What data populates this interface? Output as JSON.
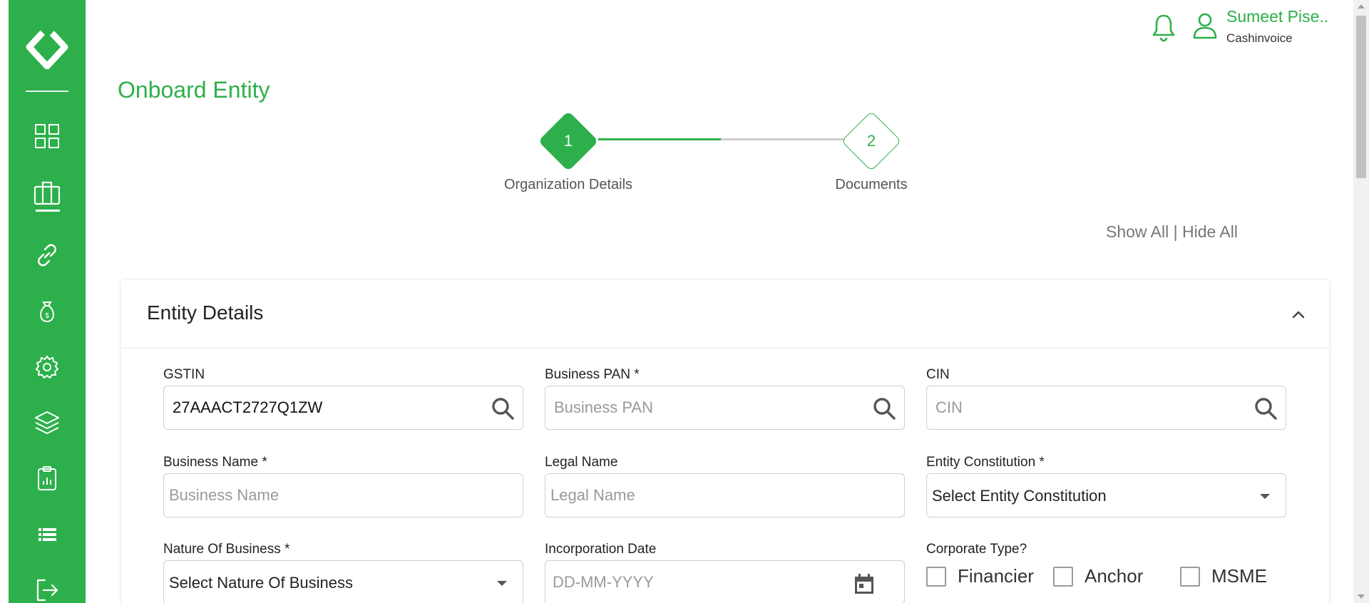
{
  "brand": {
    "accent": "#2db04b"
  },
  "sidebar": {
    "items": [
      {
        "icon": "dashboard-grid-icon"
      },
      {
        "icon": "briefcase-icon",
        "active": true
      },
      {
        "icon": "link-icon"
      },
      {
        "icon": "money-bag-icon"
      },
      {
        "icon": "gear-icon"
      },
      {
        "icon": "layers-icon"
      },
      {
        "icon": "clipboard-icon"
      },
      {
        "icon": "list-icon"
      },
      {
        "icon": "logout-icon"
      }
    ]
  },
  "header": {
    "user_name": "Sumeet Pise..",
    "company": "Cashinvoice"
  },
  "page": {
    "title": "Onboard Entity"
  },
  "stepper": {
    "steps": [
      {
        "number": "1",
        "label": "Organization Details",
        "state": "completed"
      },
      {
        "number": "2",
        "label": "Documents",
        "state": "pending"
      }
    ]
  },
  "toggles": {
    "show_all": "Show All",
    "separator": " | ",
    "hide_all": "Hide All"
  },
  "section": {
    "title": "Entity Details",
    "fields": {
      "gstin": {
        "label": "GSTIN",
        "value": "27AAACT2727Q1ZW",
        "placeholder": ""
      },
      "business_pan": {
        "label": "Business PAN *",
        "value": "",
        "placeholder": "Business PAN"
      },
      "cin": {
        "label": "CIN",
        "value": "",
        "placeholder": "CIN"
      },
      "business_name": {
        "label": "Business Name *",
        "value": "",
        "placeholder": "Business Name"
      },
      "legal_name": {
        "label": "Legal Name",
        "value": "",
        "placeholder": "Legal Name"
      },
      "entity_constitution": {
        "label": "Entity Constitution *",
        "selected": "Select Entity Constitution"
      },
      "nature_of_business": {
        "label": "Nature Of Business *",
        "selected": "Select Nature Of Business"
      },
      "incorporation_date": {
        "label": "Incorporation Date",
        "value": "",
        "placeholder": "DD-MM-YYYY"
      },
      "corporate_type": {
        "label": "Corporate Type?",
        "options": [
          "Financier",
          "Anchor",
          "MSME"
        ]
      }
    }
  }
}
